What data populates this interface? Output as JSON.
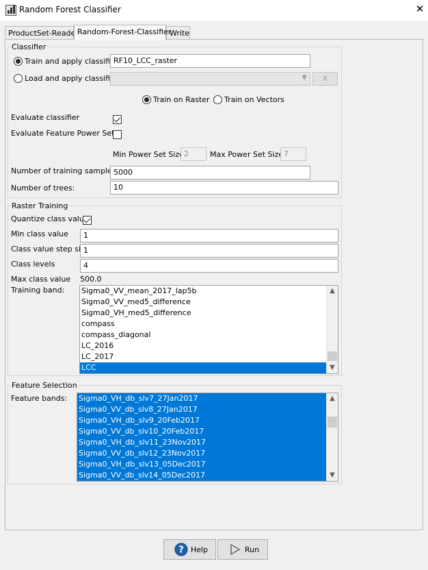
{
  "window": {
    "title": "Random Forest Classifier",
    "close_glyph": "✕"
  },
  "tabs": [
    {
      "label": "ProductSet-Reader",
      "active": false
    },
    {
      "label": "Random-Forest-Classifier",
      "active": true
    },
    {
      "label": "Write",
      "active": false
    }
  ],
  "classifier": {
    "group_title": "Classifier",
    "train_apply_label": "Train and apply classifier",
    "train_apply_value": "RF10_LCC_raster",
    "train_apply_selected": true,
    "load_apply_label": "Load and apply classifier",
    "load_apply_selected": false,
    "load_clear_label": "X",
    "train_on_raster_label": "Train on Raster",
    "train_on_raster_selected": true,
    "train_on_vectors_label": "Train on Vectors",
    "train_on_vectors_selected": false,
    "evaluate_classifier_label": "Evaluate classifier",
    "evaluate_classifier_checked": true,
    "evaluate_power_set_label": "Evaluate Feature Power Set",
    "evaluate_power_set_checked": false,
    "min_power_set_label": "Min Power Set Size:",
    "min_power_set_value": "2",
    "max_power_set_label": "Max Power Set Size:",
    "max_power_set_value": "7",
    "num_samples_label": "Number of training samples",
    "num_samples_value": "5000",
    "num_trees_label": "Number of trees:",
    "num_trees_value": "10"
  },
  "raster_training": {
    "group_title": "Raster Training",
    "quantize_label": "Quantize class value",
    "quantize_checked": true,
    "min_class_label": "Min class value",
    "min_class_value": "1",
    "step_label": "Class value step size",
    "step_value": "1",
    "levels_label": "Class levels",
    "levels_value": "4",
    "max_class_label": "Max class value",
    "max_class_value": "500.0",
    "training_band_label": "Training band:",
    "training_bands": [
      "Sigma0_VV_mean_2017_lap5b",
      "Sigma0_VV_med5_difference",
      "Sigma0_VH_med5_difference",
      "compass",
      "compass_diagonal",
      "LC_2016",
      "LC_2017",
      "LCC"
    ],
    "selected_band": "LCC"
  },
  "feature_selection": {
    "group_title": "Feature Selection",
    "feature_bands_label": "Feature bands:",
    "feature_bands": [
      "Sigma0_VH_db_slv7_27Jan2017",
      "Sigma0_VV_db_slv8_27Jan2017",
      "Sigma0_VH_db_slv9_20Feb2017",
      "Sigma0_VV_db_slv10_20Feb2017",
      "Sigma0_VH_db_slv11_23Nov2017",
      "Sigma0_VV_db_slv12_23Nov2017",
      "Sigma0_VH_db_slv13_05Dec2017",
      "Sigma0_VV_db_slv14_05Dec2017"
    ],
    "all_selected": true
  },
  "footer": {
    "help_label": "Help",
    "help_icon": "help-circle-icon",
    "run_label": "Run",
    "run_icon": "play-icon"
  },
  "colors": {
    "selection": "#0078d7",
    "help_icon": "#1f5fa8"
  }
}
